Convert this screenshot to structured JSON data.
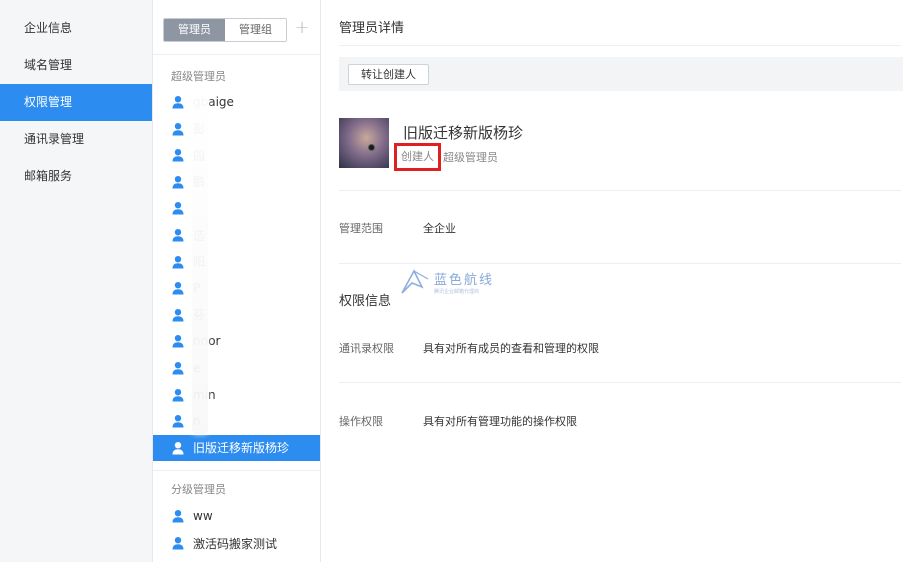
{
  "nav": {
    "items": [
      {
        "label": "企业信息",
        "active": false
      },
      {
        "label": "域名管理",
        "active": false
      },
      {
        "label": "权限管理",
        "active": true
      },
      {
        "label": "通讯录管理",
        "active": false
      },
      {
        "label": "邮箱服务",
        "active": false
      }
    ]
  },
  "list": {
    "tabs": [
      {
        "label": "管理员",
        "active": true
      },
      {
        "label": "管理组",
        "active": false
      }
    ],
    "add_label": "+",
    "super_title": "超级管理员",
    "super_admins": [
      {
        "name": "gbaige"
      },
      {
        "name": "彭"
      },
      {
        "name": "园"
      },
      {
        "name": "鹏"
      },
      {
        "name": ""
      },
      {
        "name": "造"
      },
      {
        "name": "阳"
      },
      {
        "name": "P"
      },
      {
        "name": "芬"
      },
      {
        "name": "nnor"
      },
      {
        "name": "e"
      },
      {
        "name": "min"
      },
      {
        "name": "n"
      },
      {
        "name": "旧版迁移新版杨珍",
        "active": true
      }
    ],
    "sub_title": "分级管理员",
    "sub_admins": [
      {
        "name": "ww"
      },
      {
        "name": "激活码搬家测试"
      }
    ]
  },
  "detail": {
    "title": "管理员详情",
    "transfer_label": "转让创建人",
    "admin_name": "旧版迁移新版杨珍",
    "creator_tag": "创建人",
    "role": "超级管理员",
    "scope_label": "管理范围",
    "scope_value": "全企业",
    "perm_title": "权限信息",
    "contacts_label": "通讯录权限",
    "contacts_value": "具有对所有成员的查看和管理的权限",
    "ops_label": "操作权限",
    "ops_value": "具有对所有管理功能的操作权限"
  },
  "watermark": {
    "text": "蓝色航线",
    "sub": "腾讯企业邮箱代理商"
  },
  "colors": {
    "accent": "#2d8cf0",
    "highlight_box": "#e02020"
  },
  "icons": {
    "person": "person-icon",
    "add": "plus-icon"
  }
}
